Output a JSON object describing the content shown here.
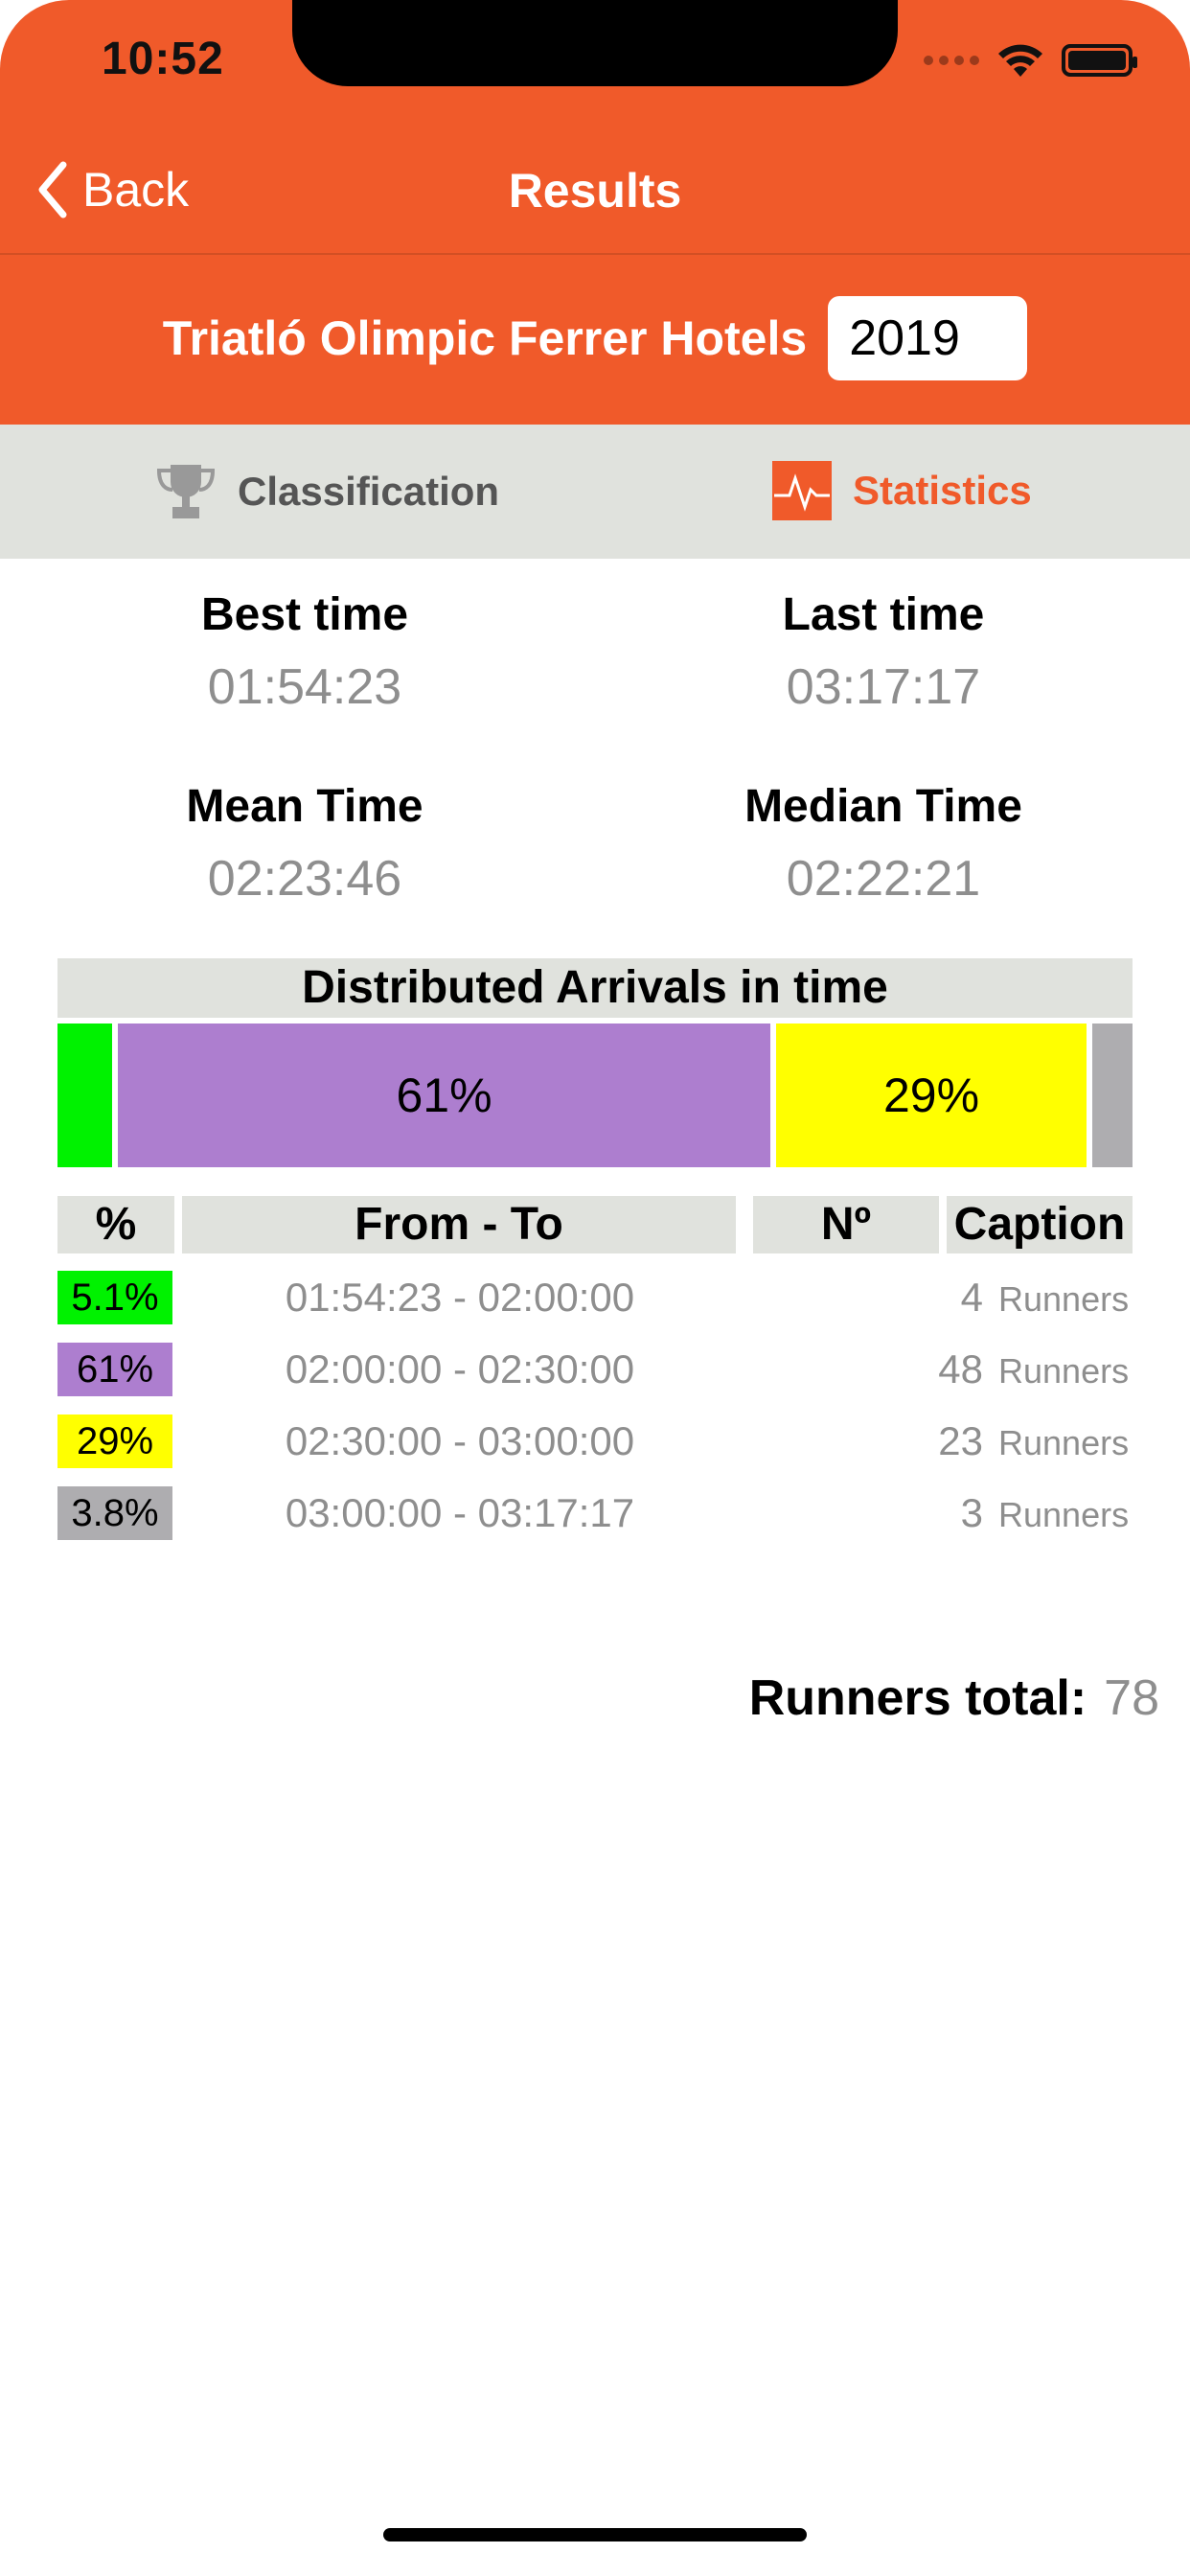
{
  "status_bar": {
    "time": "10:52"
  },
  "nav": {
    "back_label": "Back",
    "title": "Results"
  },
  "event": {
    "name": "Triatló Olimpic Ferrer Hotels",
    "year": "2019"
  },
  "tabs": [
    {
      "label": "Classification",
      "icon": "trophy-icon",
      "active": false
    },
    {
      "label": "Statistics",
      "icon": "chart-icon",
      "active": true
    }
  ],
  "stats": {
    "best": {
      "label": "Best time",
      "value": "01:54:23"
    },
    "last": {
      "label": "Last time",
      "value": "03:17:17"
    },
    "mean": {
      "label": "Mean Time",
      "value": "02:23:46"
    },
    "median": {
      "label": "Median Time",
      "value": "02:22:21"
    }
  },
  "distribution": {
    "title": "Distributed Arrivals in time",
    "segments": [
      {
        "pct": 5.1,
        "label": "",
        "color": "#00f200"
      },
      {
        "pct": 61,
        "label": "61%",
        "color": "#ad7ecf"
      },
      {
        "pct": 29,
        "label": "29%",
        "color": "#ffff00"
      },
      {
        "pct": 3.8,
        "label": "",
        "color": "#aeadb0"
      }
    ]
  },
  "table": {
    "headers": {
      "pct": "%",
      "range": "From - To",
      "number": "Nº",
      "caption": "Caption"
    },
    "rows": [
      {
        "pct": "5.1%",
        "range": "01:54:23 - 02:00:00",
        "count": "4",
        "caption": "Runners",
        "color": "#00f200"
      },
      {
        "pct": "61%",
        "range": "02:00:00 - 02:30:00",
        "count": "48",
        "caption": "Runners",
        "color": "#ad7ecf"
      },
      {
        "pct": "29%",
        "range": "02:30:00 - 03:00:00",
        "count": "23",
        "caption": "Runners",
        "color": "#ffff00"
      },
      {
        "pct": "3.8%",
        "range": "03:00:00 - 03:17:17",
        "count": "3",
        "caption": "Runners",
        "color": "#aeadb0"
      }
    ]
  },
  "total": {
    "label": "Runners total:",
    "value": "78"
  },
  "colors": {
    "accent": "#f05a2a",
    "tab_bg": "#e0e2dd",
    "muted": "#8e8e8e"
  }
}
